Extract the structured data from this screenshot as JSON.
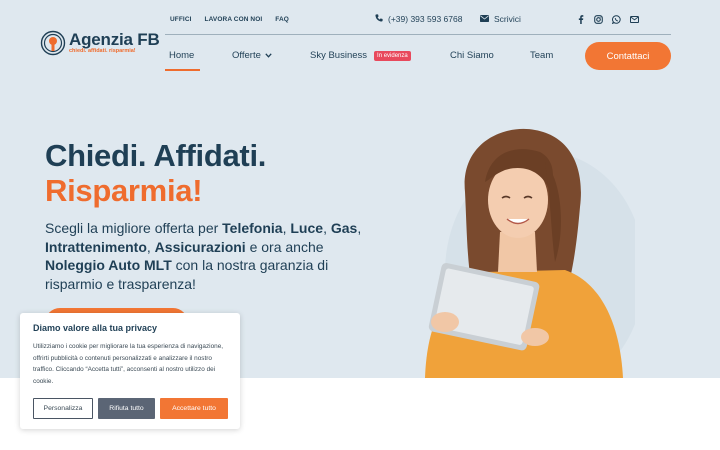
{
  "logo": {
    "title": "Agenzia FB",
    "tagline": "chiedi. affidati. risparmia!"
  },
  "topbar": {
    "links": [
      "UFFICI",
      "LAVORA CON NOI",
      "FAQ"
    ],
    "phone": "(+39) 393 593 6768",
    "email_label": "Scrivici",
    "socials": [
      "facebook-icon",
      "instagram-icon",
      "whatsapp-icon",
      "mail-icon"
    ]
  },
  "nav": {
    "home": "Home",
    "offerte": "Offerte",
    "sky": "Sky Business",
    "sky_badge": "In evidenza",
    "chi": "Chi Siamo",
    "team": "Team",
    "cta": "Contattaci"
  },
  "hero": {
    "line1": "Chiedi. Affidati.",
    "line2": "Risparmia!",
    "p": {
      "t1": "Scegli la migliore offerta per ",
      "b1": "Telefonia",
      "t2": ", ",
      "b2": "Luce",
      "t3": ", ",
      "b3": "Gas",
      "t4": ", ",
      "b4": "Intrattenimento",
      "t5": ", ",
      "b5": "Assicurazioni",
      "t6": " e ora anche ",
      "b6": "Noleggio Auto MLT",
      "t7": " con la nostra garanzia di risparmio e trasparenza!"
    }
  },
  "cookie": {
    "title": "Diamo valore alla tua privacy",
    "text": "Utilizziamo i cookie per migliorare la tua esperienza di navigazione, offrirti pubblicità o contenuti personalizzati e analizzare il nostro traffico. Cliccando “Accetta tutti”, acconsenti al nostro utilizzo dei cookie.",
    "customize": "Personalizza",
    "reject": "Rifiuta tutto",
    "accept": "Accettare tutto"
  },
  "colors": {
    "accent": "#f27634",
    "navy": "#1f3f55",
    "hero_bg": "#dfe8ef",
    "badge": "#e8495c"
  }
}
